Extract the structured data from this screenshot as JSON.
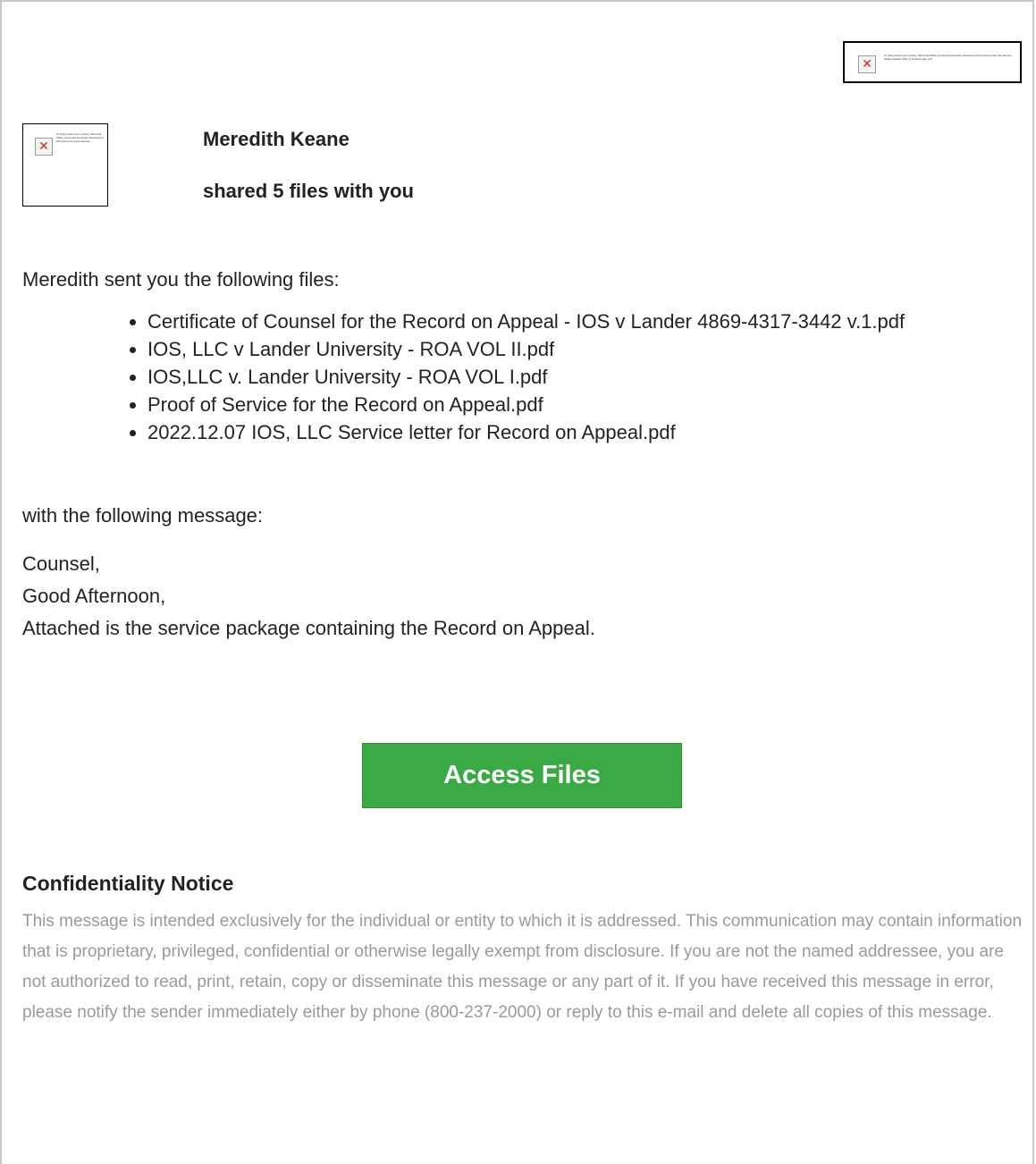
{
  "images": {
    "logo_alt": "To help protect your privacy, Microsoft Office prevented automatic download of this picture from the Internet. Nelson Mullins Riley & Scarborough LLP",
    "avatar_alt": "To help protect your privacy, Microsoft Office prevented automatic download of this picture from the Internet.",
    "broken_icon": "red-x-icon"
  },
  "header": {
    "sender_name": "Meredith Keane",
    "shared_text": "shared 5 files with you"
  },
  "message": {
    "intro": "Meredith sent you the following files:",
    "files": [
      "Certificate of Counsel for the Record on Appeal - IOS v Lander 4869-4317-3442 v.1.pdf",
      "IOS, LLC v Lander University - ROA VOL II.pdf",
      "IOS,LLC v. Lander University - ROA VOL I.pdf",
      "Proof of Service for the Record on Appeal.pdf",
      "2022.12.07 IOS, LLC Service letter for Record on Appeal.pdf"
    ],
    "with_message": "with the following message:",
    "lines": [
      "Counsel,",
      "Good Afternoon,",
      "Attached is the service package containing the Record on Appeal."
    ]
  },
  "button": {
    "label": "Access Files",
    "color": "#3aaa44"
  },
  "confidentiality": {
    "title": "Confidentiality Notice",
    "text": "This message is intended exclusively for the individual or entity to which it is addressed. This communication may contain information that is proprietary, privileged, confidential or otherwise legally exempt from disclosure. If you are not the named addressee, you are not authorized to read, print, retain, copy or disseminate this message or any part of it. If you have received this message in error, please notify the sender immediately either by phone (800-237-2000) or reply to this e-mail and delete all copies of this message."
  }
}
